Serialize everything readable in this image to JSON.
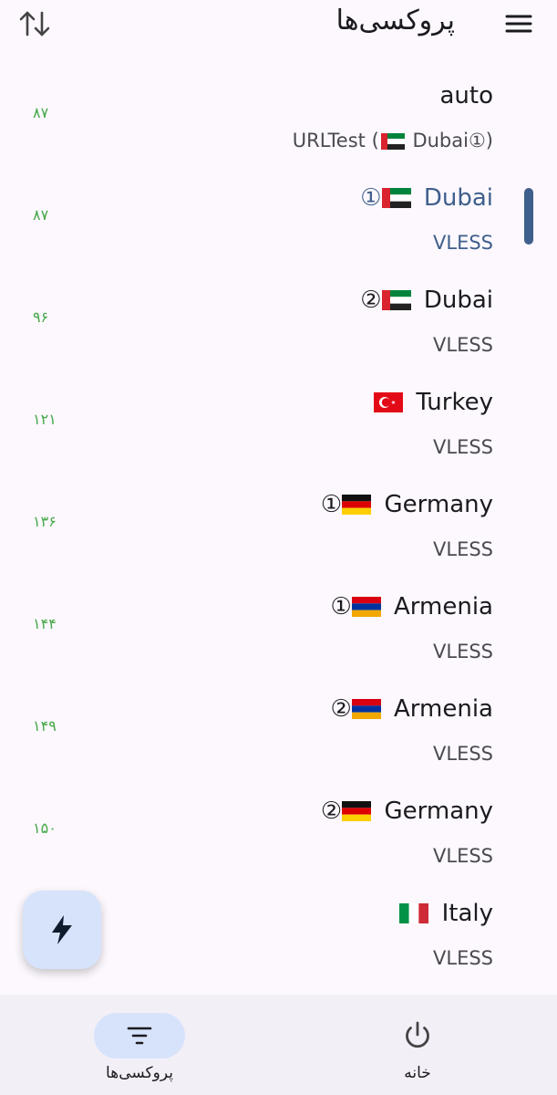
{
  "app_bar": {
    "title": "پروکسی‌ها",
    "sort_icon": "swap-vertical-icon",
    "menu_icon": "menu-icon"
  },
  "proxies": [
    {
      "name": "auto",
      "type_prefix": "URLTest (",
      "type_flag": "ae",
      "type_suffix": " Dubai①)",
      "ping": "۸۷",
      "flag": "",
      "prefix": "",
      "selected": false
    },
    {
      "prefix": "①",
      "flag": "ae",
      "name": " Dubai",
      "type": "VLESS",
      "ping": "۸۷",
      "selected": true
    },
    {
      "prefix": "②",
      "flag": "ae",
      "name": " Dubai",
      "type": "VLESS",
      "ping": "۹۶",
      "selected": false
    },
    {
      "prefix": "",
      "flag": "tr",
      "name": " Turkey",
      "type": "VLESS",
      "ping": "۱۲۱",
      "selected": false
    },
    {
      "prefix": "①",
      "flag": "de",
      "name": " Germany",
      "type": "VLESS",
      "ping": "۱۳۶",
      "selected": false
    },
    {
      "prefix": "①",
      "flag": "am",
      "name": " Armenia",
      "type": "VLESS",
      "ping": "۱۴۴",
      "selected": false
    },
    {
      "prefix": "②",
      "flag": "am",
      "name": " Armenia",
      "type": "VLESS",
      "ping": "۱۴۹",
      "selected": false
    },
    {
      "prefix": "②",
      "flag": "de",
      "name": " Germany",
      "type": "VLESS",
      "ping": "۱۵۰",
      "selected": false
    },
    {
      "prefix": "",
      "flag": "it",
      "name": " Italy",
      "type": "VLESS",
      "ping": "",
      "selected": false
    }
  ],
  "fab": {
    "icon": "bolt-icon"
  },
  "bottom_nav": {
    "items": [
      {
        "label": "پروکسی‌ها",
        "icon": "filter-list-icon",
        "active": true
      },
      {
        "label": "خانه",
        "icon": "power-icon",
        "active": false
      }
    ]
  },
  "colors": {
    "accent": "#3f5f8c",
    "ping": "#46a84a",
    "pill": "#d7e3fb",
    "background": "#fcf8fd"
  }
}
